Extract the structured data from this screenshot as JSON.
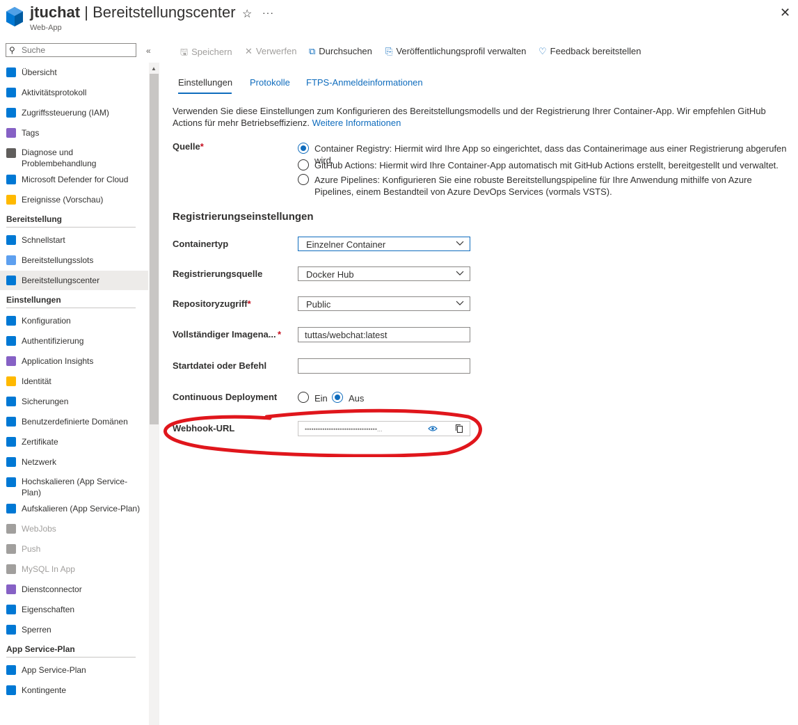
{
  "header": {
    "app_name": "jtuchat",
    "separator": "|",
    "page_name": "Bereitstellungscenter",
    "subtitle": "Web-App",
    "star_glyph": "☆",
    "more_glyph": "···",
    "close_glyph": "✕"
  },
  "sidebar": {
    "search_placeholder": "Suche",
    "collapse_glyph": "«",
    "items": [
      {
        "label": "Übersicht",
        "icon": "overview-icon",
        "color": "#0078d4"
      },
      {
        "label": "Aktivitätsprotokoll",
        "icon": "activity-log-icon",
        "color": "#0078d4"
      },
      {
        "label": "Zugriffssteuerung (IAM)",
        "icon": "iam-icon",
        "color": "#0078d4"
      },
      {
        "label": "Tags",
        "icon": "tag-icon",
        "color": "#8661c5"
      },
      {
        "label": "Diagnose und Problembehandlung",
        "icon": "wrench-icon",
        "color": "#605e5c"
      },
      {
        "label": "Microsoft Defender for Cloud",
        "icon": "shield-icon",
        "color": "#0078d4"
      },
      {
        "label": "Ereignisse (Vorschau)",
        "icon": "lightning-icon",
        "color": "#ffb900"
      }
    ],
    "sections": [
      {
        "title": "Bereitstellung",
        "items": [
          {
            "label": "Schnellstart",
            "icon": "cloud-icon",
            "color": "#0078d4"
          },
          {
            "label": "Bereitstellungsslots",
            "icon": "slots-icon",
            "color": "#5ea0ef"
          },
          {
            "label": "Bereitstellungscenter",
            "icon": "cube-icon",
            "color": "#0078d4",
            "active": true
          }
        ]
      },
      {
        "title": "Einstellungen",
        "items": [
          {
            "label": "Konfiguration",
            "icon": "config-icon",
            "color": "#0078d4"
          },
          {
            "label": "Authentifizierung",
            "icon": "users-icon",
            "color": "#0078d4"
          },
          {
            "label": "Application Insights",
            "icon": "bulb-icon",
            "color": "#8661c5"
          },
          {
            "label": "Identität",
            "icon": "key-icon",
            "color": "#ffb900"
          },
          {
            "label": "Sicherungen",
            "icon": "backup-cloud-icon",
            "color": "#0078d4"
          },
          {
            "label": "Benutzerdefinierte Domänen",
            "icon": "domain-icon",
            "color": "#0078d4"
          },
          {
            "label": "Zertifikate",
            "icon": "certificate-icon",
            "color": "#0078d4"
          },
          {
            "label": "Netzwerk",
            "icon": "network-icon",
            "color": "#0078d4"
          },
          {
            "label": "Hochskalieren (App Service-Plan)",
            "icon": "scale-up-icon",
            "color": "#0078d4"
          },
          {
            "label": "Aufskalieren (App Service-Plan)",
            "icon": "scale-out-icon",
            "color": "#0078d4"
          },
          {
            "label": "WebJobs",
            "icon": "webjobs-icon",
            "color": "#a19f9d",
            "disabled": true
          },
          {
            "label": "Push",
            "icon": "push-icon",
            "color": "#a19f9d",
            "disabled": true
          },
          {
            "label": "MySQL In App",
            "icon": "mysql-icon",
            "color": "#a19f9d",
            "disabled": true
          },
          {
            "label": "Dienstconnector",
            "icon": "connector-icon",
            "color": "#8661c5"
          },
          {
            "label": "Eigenschaften",
            "icon": "properties-icon",
            "color": "#0078d4"
          },
          {
            "label": "Sperren",
            "icon": "lock-icon",
            "color": "#0078d4"
          }
        ]
      },
      {
        "title": "App Service-Plan",
        "items": [
          {
            "label": "App Service-Plan",
            "icon": "app-service-plan-icon",
            "color": "#0078d4"
          },
          {
            "label": "Kontingente",
            "icon": "quota-icon",
            "color": "#0078d4"
          }
        ]
      }
    ]
  },
  "toolbar": {
    "save": "Speichern",
    "discard": "Verwerfen",
    "browse": "Durchsuchen",
    "publish_profile": "Veröffentlichungsprofil verwalten",
    "feedback": "Feedback bereitstellen"
  },
  "tabs": {
    "settings": "Einstellungen",
    "logs": "Protokolle",
    "ftps": "FTPS-Anmeldeinformationen"
  },
  "description": {
    "text": "Verwenden Sie diese Einstellungen zum Konfigurieren des Bereitstellungsmodells und der Registrierung Ihrer Container-App. Wir empfehlen GitHub Actions für mehr Betriebseffizienz.",
    "link": "Weitere Informationen"
  },
  "form": {
    "source_label": "Quelle",
    "required_mark": "*",
    "source_options": [
      {
        "text": "Container Registry: Hiermit wird Ihre App so eingerichtet, dass das Containerimage aus einer Registrierung abgerufen wird.",
        "selected": true
      },
      {
        "text": "GitHub Actions: Hiermit wird Ihre Container-App automatisch mit GitHub Actions erstellt, bereitgestellt und verwaltet.",
        "selected": false
      },
      {
        "text": "Azure Pipelines: Konfigurieren Sie eine robuste Bereitstellungspipeline für Ihre Anwendung mithilfe von Azure Pipelines, einem Bestandteil von Azure DevOps Services (vormals VSTS).",
        "selected": false
      }
    ],
    "registry_heading": "Registrierungseinstellungen",
    "container_type_label": "Containertyp",
    "container_type_value": "Einzelner Container",
    "registry_source_label": "Registrierungsquelle",
    "registry_source_value": "Docker Hub",
    "repo_access_label": "Repositoryzugriff",
    "repo_access_value": "Public",
    "image_label": "Vollständiger Imagena...",
    "image_value": "tuttas/webchat:latest",
    "startup_label": "Startdatei oder Befehl",
    "startup_value": "",
    "cd_label": "Continuous Deployment",
    "cd_on": "Ein",
    "cd_off": "Aus",
    "cd_selected": "Aus",
    "webhook_label": "Webhook-URL",
    "webhook_masked": "•••••••••••••••••••••••••••••••••..."
  },
  "annotation": {
    "color": "#e0161c"
  }
}
